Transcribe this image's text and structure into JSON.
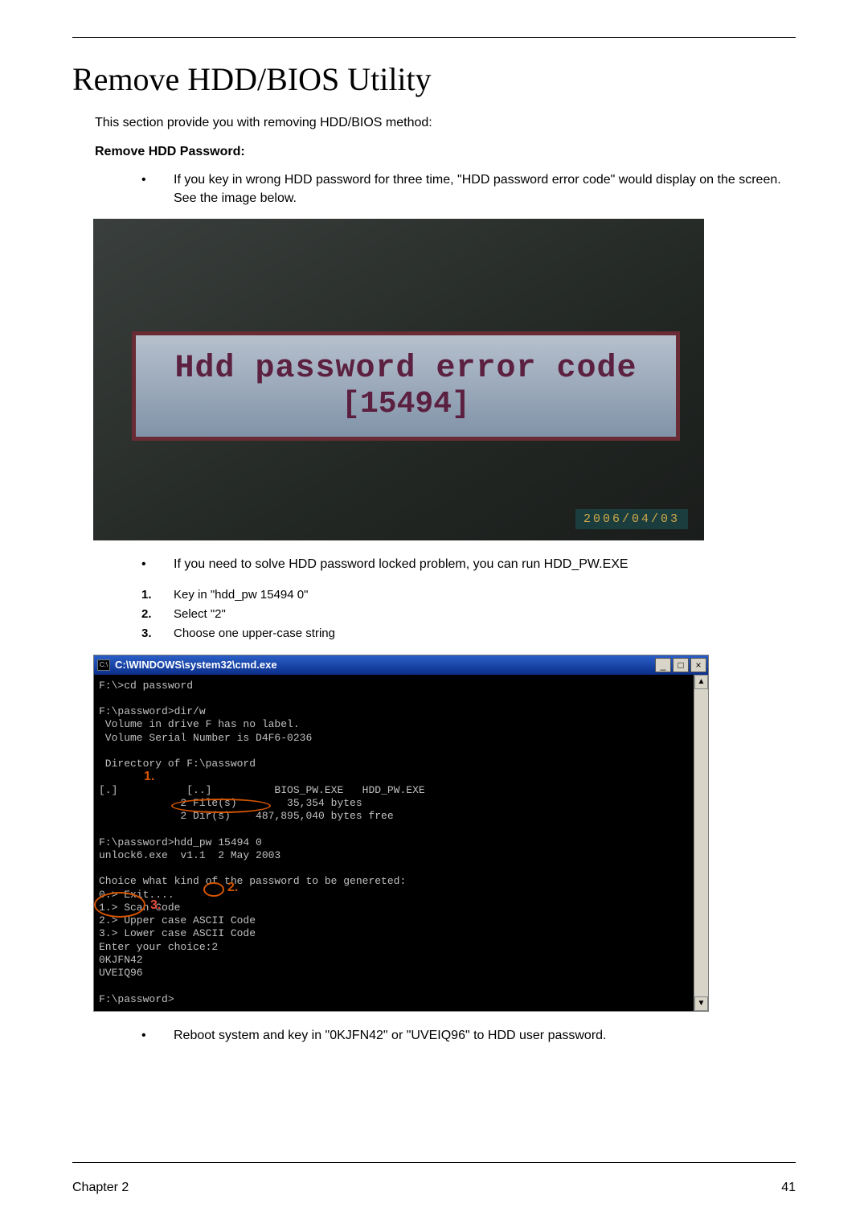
{
  "page": {
    "title": "Remove HDD/BIOS Utility",
    "intro": "This section provide you with removing HDD/BIOS method:",
    "subhead": "Remove HDD Password:",
    "bullet1": "If you key in wrong HDD password for three time, \"HDD password error code\" would display on the screen. See the image below.",
    "bullet2": "If you need to solve HDD password locked problem, you can run HDD_PW.EXE",
    "step1": "Key in \"hdd_pw 15494 0\"",
    "step2": "Select \"2\"",
    "step3": "Choose one upper-case string",
    "bullet3": "Reboot system and key in \"0KJFN42\" or \"UVEIQ96\" to HDD user password.",
    "footer_left": "Chapter 2",
    "footer_right": "41"
  },
  "shot1": {
    "line1": "Hdd password error code",
    "line2": "[15494]",
    "timestamp": "2006/04/03"
  },
  "shot2": {
    "title": "C:\\WINDOWS\\system32\\cmd.exe",
    "icon_text": "C:\\",
    "btn_min": "_",
    "btn_max": "□",
    "btn_close": "×",
    "scroll_up": "▲",
    "scroll_down": "▼",
    "ann1": "1.",
    "ann2": "2.",
    "ann3": "3.",
    "console": "F:\\>cd password\n\nF:\\password>dir/w\n Volume in drive F has no label.\n Volume Serial Number is D4F6-0236\n\n Directory of F:\\password\n\n[.]           [..]          BIOS_PW.EXE   HDD_PW.EXE\n             2 File(s)        35,354 bytes\n             2 Dir(s)    487,895,040 bytes free\n\nF:\\password>hdd_pw 15494 0\nunlock6.exe  v1.1  2 May 2003\n\nChoice what kind of the password to be genereted:\n0.> Exit....\n1.> Scan Code\n2.> Upper case ASCII Code\n3.> Lower case ASCII Code\nEnter your choice:2\n0KJFN42\nUVEIQ96\n\nF:\\password>"
  }
}
